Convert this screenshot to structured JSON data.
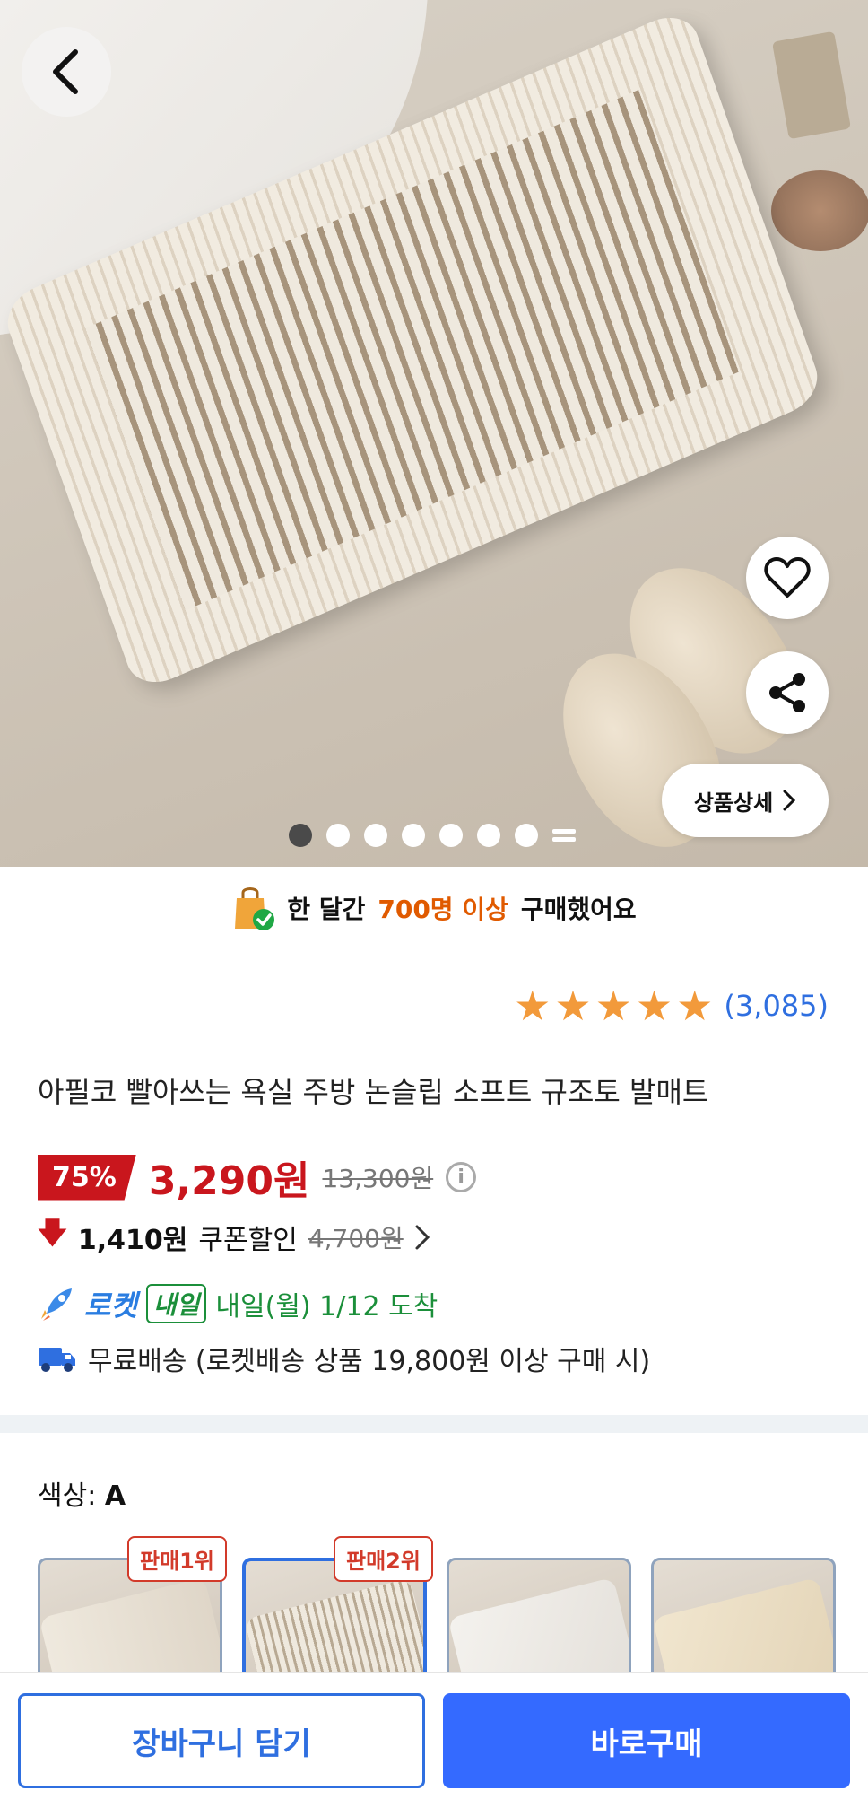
{
  "hero": {
    "carousel": {
      "total_dots": 7,
      "active_index": 0
    },
    "detail_button_label": "상품상세"
  },
  "purchased_banner": {
    "prefix": "한 달간",
    "highlight": "700명 이상",
    "suffix": "구매했어요"
  },
  "rating": {
    "stars": 5,
    "count_text": "(3,085)"
  },
  "product": {
    "title": "아필코 빨아쓰는 욕실 주방 논슬립 소프트 규조토 발매트",
    "discount_badge": "75%",
    "price": "3,290원",
    "original_price": "13,300원",
    "coupon_amount": "1,410원",
    "coupon_label": "쿠폰할인",
    "coupon_original": "4,700원"
  },
  "delivery": {
    "rocket_label": "로켓",
    "naeil_badge": "내일",
    "arrival_text": "내일(월) 1/12 도착",
    "shipping_text": "무료배송 (로켓배송 상품 19,800원 이상 구매 시)"
  },
  "options": {
    "label": "색상:",
    "selected_value": "A",
    "rank_badges": [
      "판매1위",
      "판매2위"
    ],
    "selected_index": 1
  },
  "bottom_bar": {
    "cart_label": "장바구니 담기",
    "buy_label": "바로구매"
  },
  "colors": {
    "accent_blue": "#346aff",
    "price_red": "#c9161d",
    "rocket_green": "#1b8f3a",
    "star_orange": "#f29a3b"
  }
}
